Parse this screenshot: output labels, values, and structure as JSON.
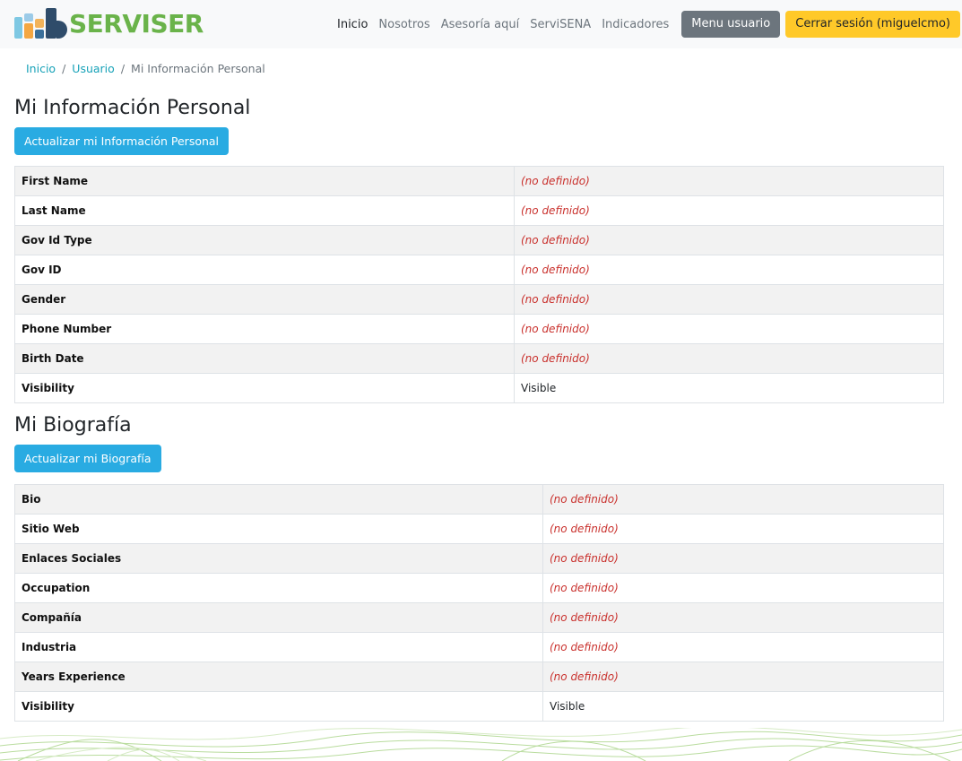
{
  "navbar": {
    "brand": "SERVISER",
    "links": [
      {
        "label": "Inicio",
        "active": true
      },
      {
        "label": "Nosotros",
        "active": false
      },
      {
        "label": "Asesoría aquí",
        "active": false
      },
      {
        "label": "ServiSENA",
        "active": false
      },
      {
        "label": "Indicadores",
        "active": false
      }
    ],
    "user_menu_label": "Menu usuario",
    "logout_label": "Cerrar sesión (miguelcmo)"
  },
  "breadcrumb": {
    "items": [
      "Inicio",
      "Usuario",
      "Mi Información Personal"
    ]
  },
  "personal": {
    "title": "Mi Información Personal",
    "update_label": "Actualizar mi Información Personal",
    "rows": [
      {
        "key": "First Name",
        "value": "(no definido)"
      },
      {
        "key": "Last Name",
        "value": "(no definido)"
      },
      {
        "key": "Gov Id Type",
        "value": "(no definido)"
      },
      {
        "key": "Gov ID",
        "value": "(no definido)"
      },
      {
        "key": "Gender",
        "value": "(no definido)"
      },
      {
        "key": "Phone Number",
        "value": "(no definido)"
      },
      {
        "key": "Birth Date",
        "value": "(no definido)"
      },
      {
        "key": "Visibility",
        "value": "Visible"
      }
    ]
  },
  "bio": {
    "title": "Mi Biografía",
    "update_label": "Actualizar mi Biografía",
    "rows": [
      {
        "key": "Bio",
        "value": "(no definido)"
      },
      {
        "key": "Sitio Web",
        "value": "(no definido)"
      },
      {
        "key": "Enlaces Sociales",
        "value": "(no definido)"
      },
      {
        "key": "Occupation",
        "value": "(no definido)"
      },
      {
        "key": "Compañía",
        "value": "(no definido)"
      },
      {
        "key": "Industria",
        "value": "(no definido)"
      },
      {
        "key": "Years Experience",
        "value": "(no definido)"
      },
      {
        "key": "Visibility",
        "value": "Visible"
      }
    ]
  },
  "colors": {
    "brand_green": "#6ab34a",
    "info_button": "#29abe2",
    "warning_button": "#ffc929",
    "secondary_button": "#6c757d",
    "undefined_text": "#c9302c",
    "link": "#17a2b8"
  }
}
